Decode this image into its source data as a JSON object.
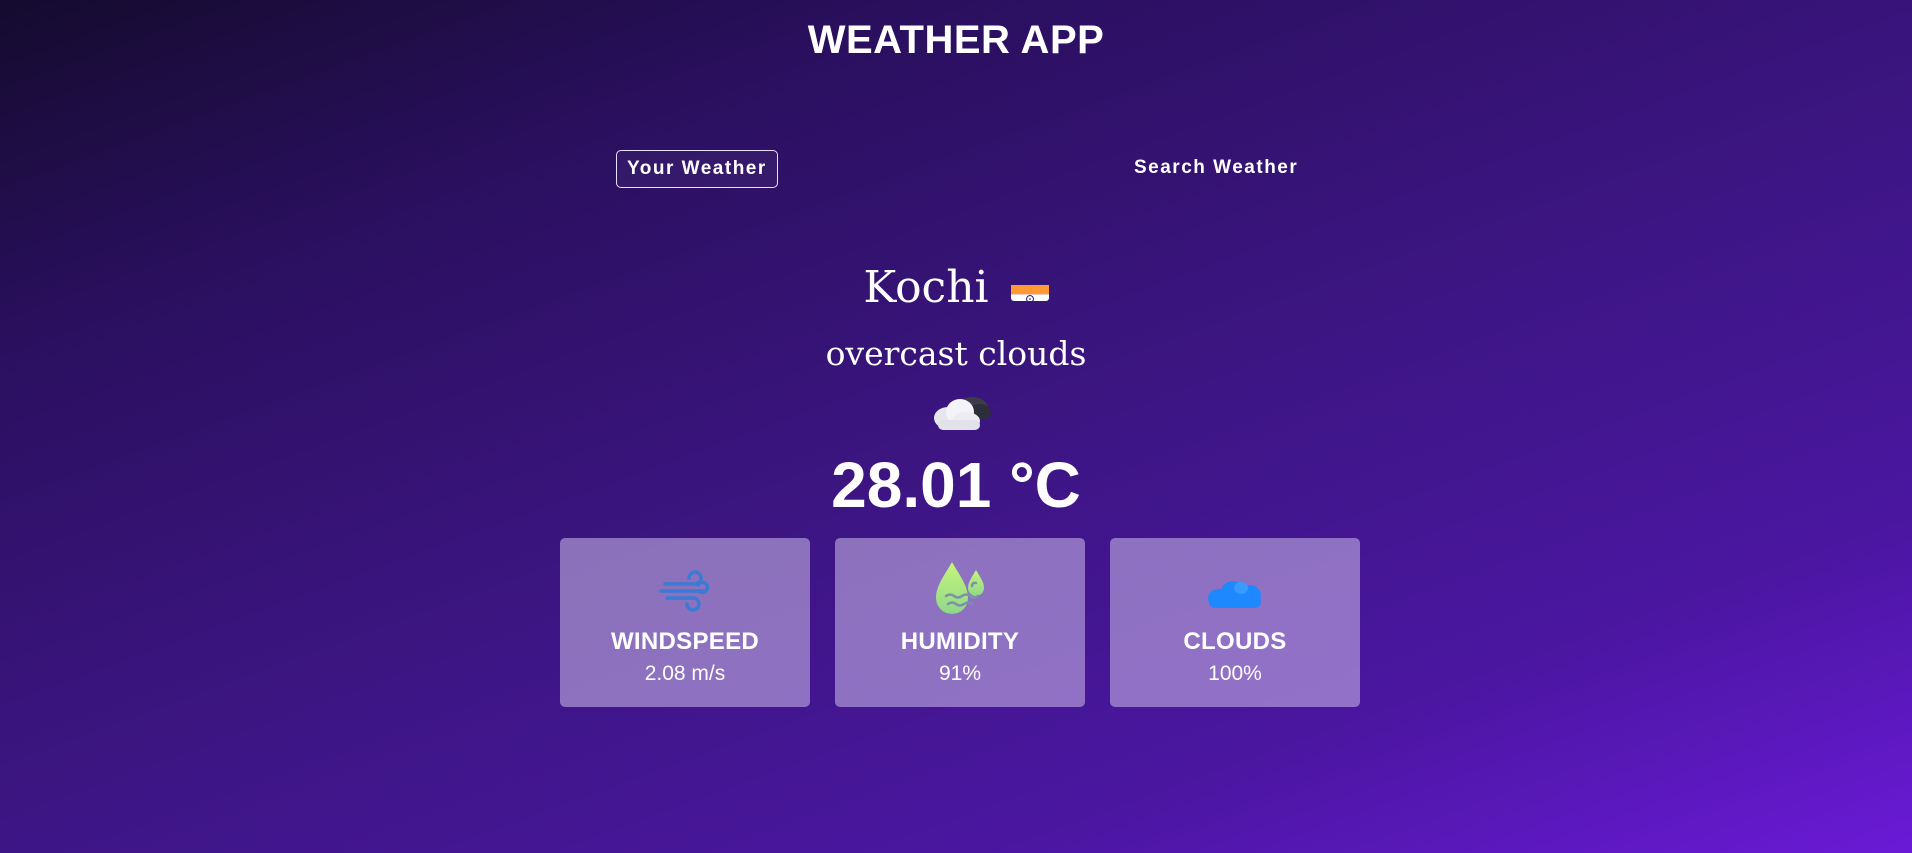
{
  "header": {
    "title": "WEATHER APP"
  },
  "tabs": [
    {
      "label": "Your Weather",
      "active": true
    },
    {
      "label": "Search Weather",
      "active": false
    }
  ],
  "weather": {
    "city": "Kochi",
    "country_flag": "india-flag-icon",
    "description": "overcast clouds",
    "condition_icon": "cloud-moon-icon",
    "temperature": "28.01 °C"
  },
  "stats": [
    {
      "label": "WINDSPEED",
      "value": "2.08 m/s",
      "icon": "wind-icon",
      "icon_color": "#3a7bd5"
    },
    {
      "label": "HUMIDITY",
      "value": "91%",
      "icon": "humidity-drops-icon",
      "icon_color": "#b8f07a"
    },
    {
      "label": "CLOUDS",
      "value": "100%",
      "icon": "clouds-icon",
      "icon_color": "#1e88ff"
    }
  ],
  "colors": {
    "background_start": "#140b2e",
    "background_end": "#6a1ad6",
    "card_background": "#a08cd2",
    "tab_border": "#e9dfff"
  }
}
